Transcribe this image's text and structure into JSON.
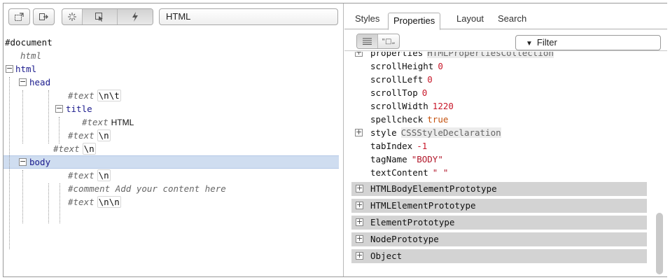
{
  "left_toolbar": {
    "buttons": [
      "select-element-icon",
      "export-icon"
    ],
    "tool_group": [
      "pick-element-icon",
      "pointer-icon",
      "lightning-icon"
    ],
    "language": "HTML"
  },
  "dom_tree": {
    "document": "#document",
    "doctype": "html",
    "html": "html",
    "head": "head",
    "text1": "#text",
    "text1_val": "\\n\\t",
    "title": "title",
    "title_text": "#text",
    "title_text_val": "HTML",
    "text2": "#text",
    "text2_val": "\\n",
    "text3": "#text",
    "text3_val": "\\n",
    "body": "body",
    "text4": "#text",
    "text4_val": "\\n",
    "comment": "#comment Add your content here",
    "text5": "#text",
    "text5_val": "\\n\\n"
  },
  "tabs": [
    "Styles",
    "Properties",
    "Layout",
    "Search"
  ],
  "active_tab": "Properties",
  "filter": {
    "placeholder": "Filter"
  },
  "properties": [
    {
      "name": "properties",
      "value": "HTMLPropertiesCollection",
      "kind": "obj",
      "expandable": true
    },
    {
      "name": "scrollHeight",
      "value": "0",
      "kind": "num"
    },
    {
      "name": "scrollLeft",
      "value": "0",
      "kind": "num"
    },
    {
      "name": "scrollTop",
      "value": "0",
      "kind": "num"
    },
    {
      "name": "scrollWidth",
      "value": "1220",
      "kind": "num"
    },
    {
      "name": "spellcheck",
      "value": "true",
      "kind": "kw"
    },
    {
      "name": "style",
      "value": "CSSStyleDeclaration",
      "kind": "obj",
      "expandable": true
    },
    {
      "name": "tabIndex",
      "value": "-1",
      "kind": "num"
    },
    {
      "name": "tagName",
      "value": "\"BODY\"",
      "kind": "str"
    },
    {
      "name": "textContent",
      "value": "\" \"",
      "kind": "str"
    }
  ],
  "prototypes": [
    "HTMLBodyElementPrototype",
    "HTMLElementPrototype",
    "ElementPrototype",
    "NodePrototype",
    "Object"
  ],
  "colors": {
    "selection": "#cfddf0",
    "number": "#c8182a",
    "keyword": "#c4520e",
    "proto_bg": "#d3d3d3"
  }
}
